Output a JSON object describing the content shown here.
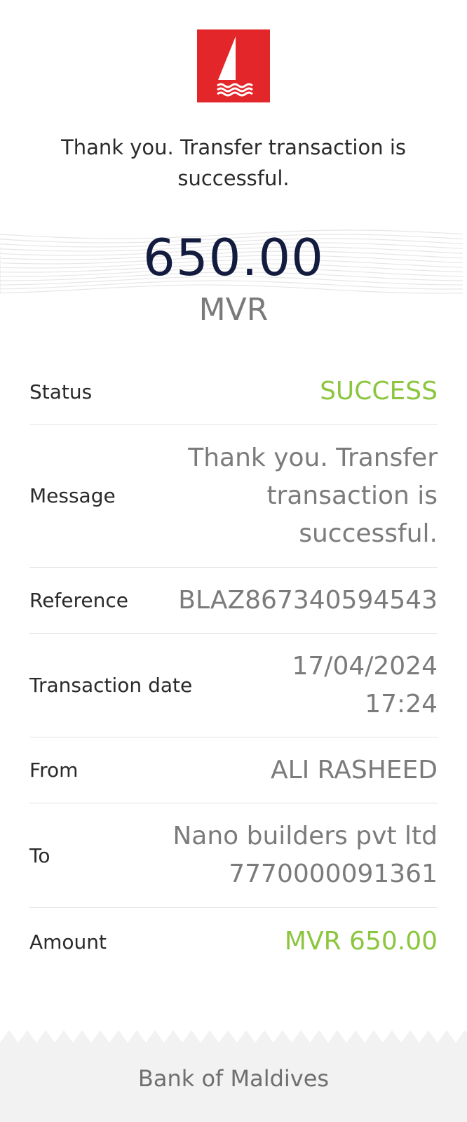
{
  "logo": {
    "icon": "sailboat-logo-icon",
    "color": "#e3262a"
  },
  "headline": "Thank you. Transfer transaction is successful.",
  "amount": {
    "value": "650.00",
    "currency": "MVR"
  },
  "details": {
    "status": {
      "label": "Status",
      "value": "SUCCESS"
    },
    "message": {
      "label": "Message",
      "value": "Thank you. Transfer transaction is successful."
    },
    "reference": {
      "label": "Reference",
      "value": "BLAZ867340594543"
    },
    "transaction_date": {
      "label": "Transaction date",
      "date": "17/04/2024",
      "time": "17:24"
    },
    "from": {
      "label": "From",
      "value": "ALI RASHEED"
    },
    "to": {
      "label": "To",
      "name": "Nano builders pvt ltd",
      "account": "7770000091361"
    },
    "amount": {
      "label": "Amount",
      "value": "MVR 650.00"
    }
  },
  "footer": {
    "text": "Bank of Maldives"
  },
  "colors": {
    "accent_green": "#8cc63f",
    "brand_red": "#e3262a",
    "amount_navy": "#131c3f",
    "footer_bg": "#f2f2f2"
  }
}
